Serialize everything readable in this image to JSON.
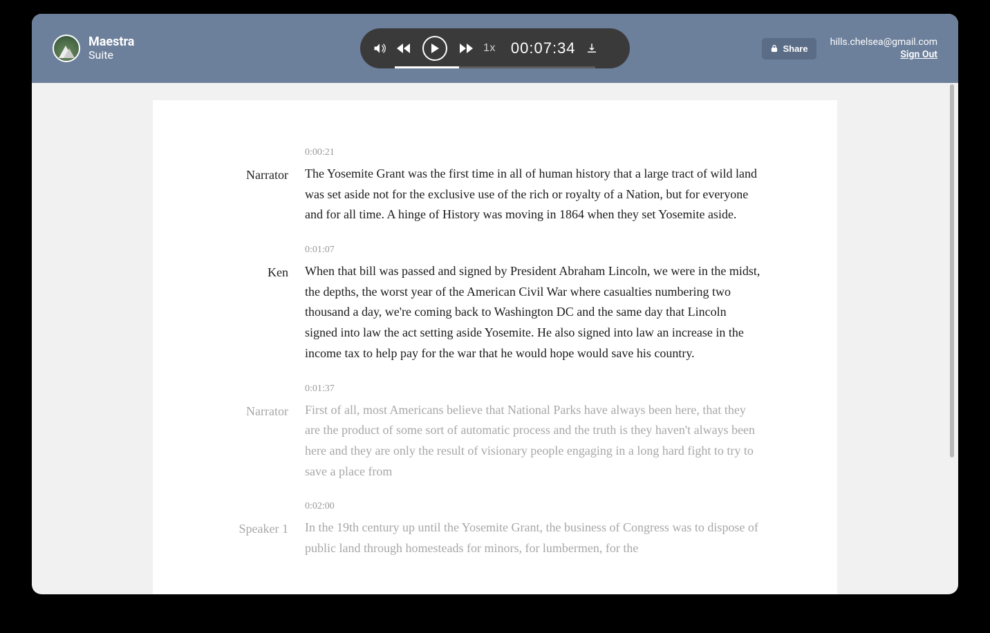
{
  "brand": {
    "name": "Maestra",
    "sub": "Suite"
  },
  "player": {
    "speed": "1x",
    "timecode": "00:07:34",
    "progress_pct": 32
  },
  "header": {
    "share_label": "Share",
    "user_email": "hills.chelsea@gmail.com",
    "signout_label": "Sign Out"
  },
  "segments": [
    {
      "speaker": "Narrator",
      "ts": "0:00:21",
      "text": "The Yosemite Grant was the first time in all of human history that a large tract of wild land was set aside not for the exclusive use of the rich or royalty of a Nation, but for everyone and for all time. A hinge of History was moving in 1864 when they set Yosemite aside.",
      "muted": false
    },
    {
      "speaker": "Ken",
      "ts": "0:01:07",
      "text": "When that bill was passed and signed by President Abraham Lincoln, we were in the midst, the depths, the worst year of the American Civil War where casualties numbering two thousand a day, we're coming back to Washington DC and the same day that Lincoln signed into law the act setting aside Yosemite. He also signed into law an increase in the income tax to help pay for the war that he would hope would save his country.",
      "muted": false
    },
    {
      "speaker": "Narrator",
      "ts": "0:01:37",
      "text": "First of all, most Americans believe that National Parks have always been here, that they are the product of some sort of automatic process and the truth is they haven't always been here and they are only the result of visionary people engaging in a long hard fight to try to save a place from",
      "muted": true
    },
    {
      "speaker": "Speaker 1",
      "ts": "0:02:00",
      "text": "In the 19th century up until the Yosemite Grant, the business of Congress was to dispose of public land through homesteads for minors, for lumbermen, for the",
      "muted": true
    }
  ]
}
